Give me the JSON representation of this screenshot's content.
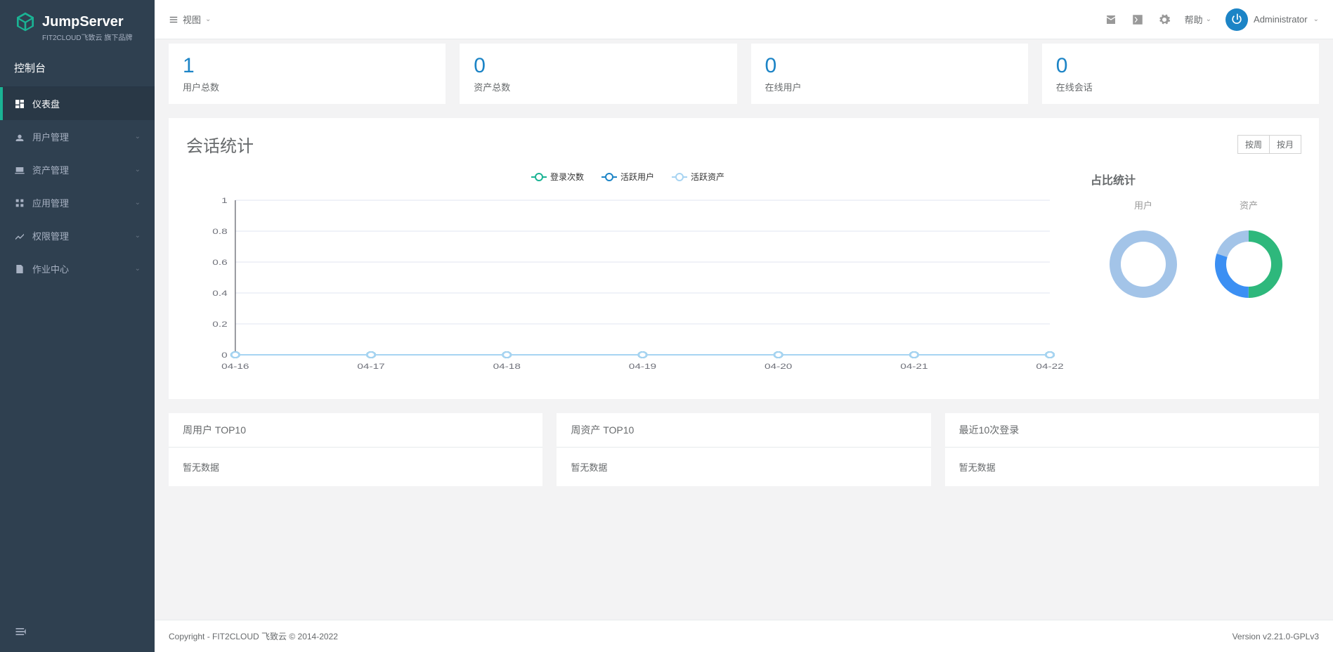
{
  "brand": {
    "name": "JumpServer",
    "tagline": "FIT2CLOUD飞致云 旗下品牌"
  },
  "sidebar": {
    "console": "控制台",
    "items": [
      {
        "label": "仪表盘",
        "icon": "dashboard",
        "active": true,
        "hasChildren": false
      },
      {
        "label": "用户管理",
        "icon": "users",
        "active": false,
        "hasChildren": true
      },
      {
        "label": "资产管理",
        "icon": "assets",
        "active": false,
        "hasChildren": true
      },
      {
        "label": "应用管理",
        "icon": "apps",
        "active": false,
        "hasChildren": true
      },
      {
        "label": "权限管理",
        "icon": "perms",
        "active": false,
        "hasChildren": true
      },
      {
        "label": "作业中心",
        "icon": "jobs",
        "active": false,
        "hasChildren": true
      }
    ]
  },
  "topbar": {
    "viewLabel": "视图",
    "help": "帮助",
    "username": "Administrator"
  },
  "stats": [
    {
      "value": "1",
      "label": "用户总数"
    },
    {
      "value": "0",
      "label": "资产总数"
    },
    {
      "value": "0",
      "label": "在线用户"
    },
    {
      "value": "0",
      "label": "在线会话"
    }
  ],
  "sessionChart": {
    "title": "会话统计",
    "buttons": {
      "week": "按周",
      "month": "按月"
    },
    "sideTitle": "占比统计",
    "donutLabels": {
      "user": "用户",
      "asset": "资产"
    }
  },
  "chart_data": {
    "type": "line",
    "categories": [
      "04-16",
      "04-17",
      "04-18",
      "04-19",
      "04-20",
      "04-21",
      "04-22"
    ],
    "ylim": [
      0,
      1
    ],
    "yticks": [
      0,
      0.2,
      0.4,
      0.6,
      0.8,
      1
    ],
    "series": [
      {
        "name": "登录次数",
        "color": "#1ab394",
        "values": [
          0,
          0,
          0,
          0,
          0,
          0,
          0
        ]
      },
      {
        "name": "活跃用户",
        "color": "#1c84c6",
        "values": [
          0,
          0,
          0,
          0,
          0,
          0,
          0
        ]
      },
      {
        "name": "活跃资产",
        "color": "#a7d4f2",
        "values": [
          0,
          0,
          0,
          0,
          0,
          0,
          0
        ]
      }
    ],
    "donuts": [
      {
        "name": "用户",
        "segments": [
          {
            "color": "#a3c4e8",
            "value": 100
          }
        ]
      },
      {
        "name": "资产",
        "segments": [
          {
            "color": "#2eb87c",
            "value": 50
          },
          {
            "color": "#3b8ff3",
            "value": 30
          },
          {
            "color": "#a3c4e8",
            "value": 20
          }
        ]
      }
    ]
  },
  "bottomCards": [
    {
      "title": "周用户 TOP10",
      "empty": "暂无数据"
    },
    {
      "title": "周资产 TOP10",
      "empty": "暂无数据"
    },
    {
      "title": "最近10次登录",
      "empty": "暂无数据"
    }
  ],
  "footer": {
    "copyright": "Copyright - FIT2CLOUD 飞致云 © 2014-2022",
    "version": "Version v2.21.0-GPLv3"
  }
}
